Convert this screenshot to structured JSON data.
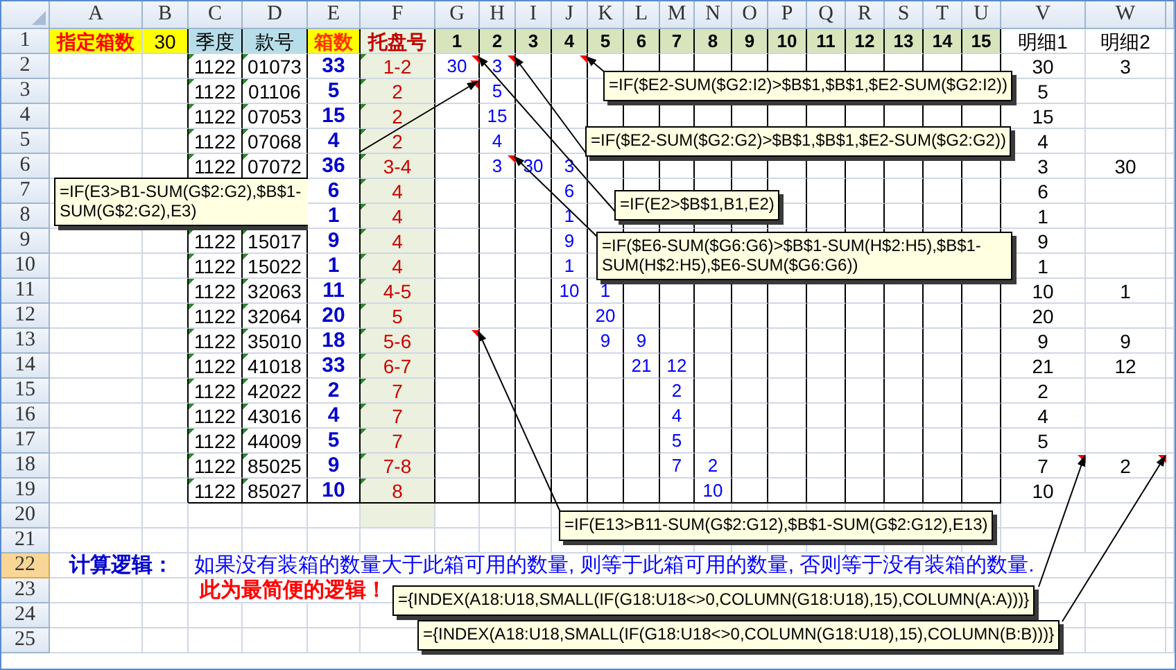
{
  "columns": [
    "A",
    "B",
    "C",
    "D",
    "E",
    "F",
    "G",
    "H",
    "I",
    "J",
    "K",
    "L",
    "M",
    "N",
    "O",
    "P",
    "Q",
    "R",
    "S",
    "T",
    "U",
    "V",
    "W"
  ],
  "rows": [
    {
      "label": "1",
      "selected": false,
      "cells": [
        "指定箱数",
        "30",
        "季度",
        "款号",
        "箱数",
        "托盘号",
        "1",
        "2",
        "3",
        "4",
        "5",
        "6",
        "7",
        "8",
        "9",
        "10",
        "11",
        "12",
        "13",
        "14",
        "15",
        "明细1",
        "明细2"
      ]
    },
    {
      "label": "2",
      "selected": false,
      "cells": [
        null,
        null,
        "1122",
        "01073",
        "33",
        "1-2",
        "30",
        "3",
        null,
        null,
        null,
        null,
        null,
        null,
        null,
        null,
        null,
        null,
        null,
        null,
        null,
        "30",
        "3"
      ]
    },
    {
      "label": "3",
      "selected": false,
      "cells": [
        null,
        null,
        "1122",
        "01106",
        "5",
        "2",
        null,
        "5",
        null,
        null,
        null,
        null,
        null,
        null,
        null,
        null,
        null,
        null,
        null,
        null,
        null,
        "5",
        null
      ]
    },
    {
      "label": "4",
      "selected": false,
      "cells": [
        null,
        null,
        "1122",
        "07053",
        "15",
        "2",
        null,
        "15",
        null,
        null,
        null,
        null,
        null,
        null,
        null,
        null,
        null,
        null,
        null,
        null,
        null,
        "15",
        null
      ]
    },
    {
      "label": "5",
      "selected": false,
      "cells": [
        null,
        null,
        "1122",
        "07068",
        "4",
        "2",
        null,
        "4",
        null,
        null,
        null,
        null,
        null,
        null,
        null,
        null,
        null,
        null,
        null,
        null,
        null,
        "4",
        null
      ]
    },
    {
      "label": "6",
      "selected": false,
      "cells": [
        null,
        null,
        "1122",
        "07072",
        "36",
        "3-4",
        null,
        "3",
        "30",
        "3",
        null,
        null,
        null,
        null,
        null,
        null,
        null,
        null,
        null,
        null,
        null,
        "3",
        "30"
      ]
    },
    {
      "label": "7",
      "selected": false,
      "cells": [
        null,
        null,
        null,
        null,
        "6",
        "4",
        null,
        null,
        null,
        "6",
        null,
        null,
        null,
        null,
        null,
        null,
        null,
        null,
        null,
        null,
        null,
        "6",
        null
      ]
    },
    {
      "label": "8",
      "selected": false,
      "cells": [
        null,
        null,
        null,
        null,
        "1",
        "4",
        null,
        null,
        null,
        "1",
        null,
        null,
        null,
        null,
        null,
        null,
        null,
        null,
        null,
        null,
        null,
        "1",
        null
      ]
    },
    {
      "label": "9",
      "selected": false,
      "cells": [
        null,
        null,
        "1122",
        "15017",
        "9",
        "4",
        null,
        null,
        null,
        "9",
        null,
        null,
        null,
        null,
        null,
        null,
        null,
        null,
        null,
        null,
        null,
        "9",
        null
      ]
    },
    {
      "label": "10",
      "selected": false,
      "cells": [
        null,
        null,
        "1122",
        "15022",
        "1",
        "4",
        null,
        null,
        null,
        "1",
        null,
        null,
        null,
        null,
        null,
        null,
        null,
        null,
        null,
        null,
        null,
        "1",
        null
      ]
    },
    {
      "label": "11",
      "selected": false,
      "cells": [
        null,
        null,
        "1122",
        "32063",
        "11",
        "4-5",
        null,
        null,
        null,
        "10",
        "1",
        null,
        null,
        null,
        null,
        null,
        null,
        null,
        null,
        null,
        null,
        "10",
        "1"
      ]
    },
    {
      "label": "12",
      "selected": false,
      "cells": [
        null,
        null,
        "1122",
        "32064",
        "20",
        "5",
        null,
        null,
        null,
        null,
        "20",
        null,
        null,
        null,
        null,
        null,
        null,
        null,
        null,
        null,
        null,
        "20",
        null
      ]
    },
    {
      "label": "13",
      "selected": false,
      "cells": [
        null,
        null,
        "1122",
        "35010",
        "18",
        "5-6",
        null,
        null,
        null,
        null,
        "9",
        "9",
        null,
        null,
        null,
        null,
        null,
        null,
        null,
        null,
        null,
        "9",
        "9"
      ]
    },
    {
      "label": "14",
      "selected": false,
      "cells": [
        null,
        null,
        "1122",
        "41018",
        "33",
        "6-7",
        null,
        null,
        null,
        null,
        null,
        "21",
        "12",
        null,
        null,
        null,
        null,
        null,
        null,
        null,
        null,
        "21",
        "12"
      ]
    },
    {
      "label": "15",
      "selected": false,
      "cells": [
        null,
        null,
        "1122",
        "42022",
        "2",
        "7",
        null,
        null,
        null,
        null,
        null,
        null,
        "2",
        null,
        null,
        null,
        null,
        null,
        null,
        null,
        null,
        "2",
        null
      ]
    },
    {
      "label": "16",
      "selected": false,
      "cells": [
        null,
        null,
        "1122",
        "43016",
        "4",
        "7",
        null,
        null,
        null,
        null,
        null,
        null,
        "4",
        null,
        null,
        null,
        null,
        null,
        null,
        null,
        null,
        "4",
        null
      ]
    },
    {
      "label": "17",
      "selected": false,
      "cells": [
        null,
        null,
        "1122",
        "44009",
        "5",
        "7",
        null,
        null,
        null,
        null,
        null,
        null,
        "5",
        null,
        null,
        null,
        null,
        null,
        null,
        null,
        null,
        "5",
        null
      ]
    },
    {
      "label": "18",
      "selected": false,
      "cells": [
        null,
        null,
        "1122",
        "85025",
        "9",
        "7-8",
        null,
        null,
        null,
        null,
        null,
        null,
        "7",
        "2",
        null,
        null,
        null,
        null,
        null,
        null,
        null,
        "7",
        "2"
      ]
    },
    {
      "label": "19",
      "selected": false,
      "cells": [
        null,
        null,
        "1122",
        "85027",
        "10",
        "8",
        null,
        null,
        null,
        null,
        null,
        null,
        null,
        "10",
        null,
        null,
        null,
        null,
        null,
        null,
        null,
        "10",
        null
      ]
    },
    {
      "label": "20",
      "selected": false
    },
    {
      "label": "21",
      "selected": false
    },
    {
      "label": "22",
      "selected": true,
      "cells": [
        "计算逻辑：",
        null,
        "如果没有装箱的数量大于此箱可用的数量, 则等于此箱可用的数量, 否则等于没有装箱的数量."
      ]
    },
    {
      "label": "23",
      "selected": false,
      "cells": [
        null,
        null,
        "此为最简便的逻辑！"
      ]
    },
    {
      "label": "24",
      "selected": false
    },
    {
      "label": "25",
      "selected": false
    }
  ],
  "comments": [
    {
      "text": "=IF(E3>B1-SUM(G$2:G2),$B$1-SUM(G$2:G2),E3)"
    },
    {
      "text": "=IF($E2-SUM($G2:I2)>$B$1,$B$1,$E2-SUM($G2:I2))"
    },
    {
      "text": "=IF($E2-SUM($G2:G2)>$B$1,$B$1,$E2-SUM($G2:G2))"
    },
    {
      "text": "=IF(E2>$B$1,B1,E2)"
    },
    {
      "text": "=IF($E6-SUM($G6:G6)>$B$1-SUM(H$2:H5),$B$1-SUM(H$2:H5),$E6-SUM($G6:G6))"
    },
    {
      "text": "=IF(E13>B11-SUM(G$2:G12),$B$1-SUM(G$2:G12),E13)"
    },
    {
      "text": "={INDEX(A18:U18,SMALL(IF(G18:U18<>0,COLUMN(G18:U18),15),COLUMN(A:A)))}"
    },
    {
      "text": "={INDEX(A18:U18,SMALL(IF(G18:U18<>0,COLUMN(G18:U18),15),COLUMN(B:B)))}"
    }
  ]
}
